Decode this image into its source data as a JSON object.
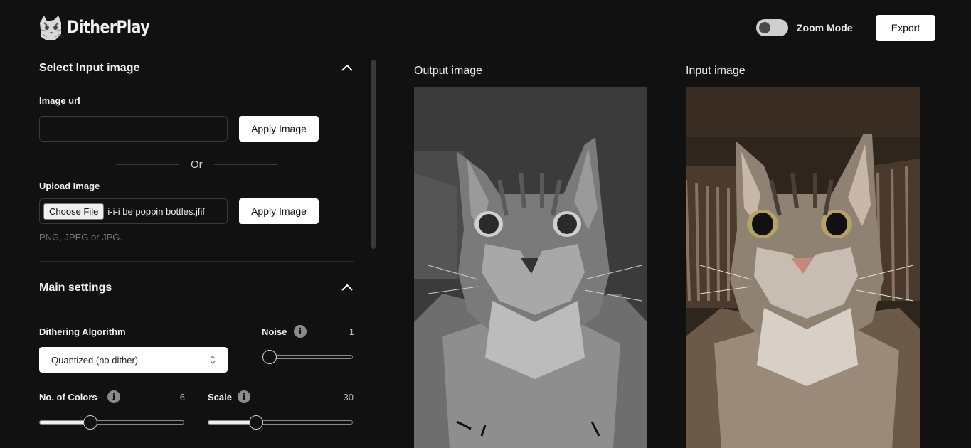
{
  "app": {
    "title": "DitherPlay"
  },
  "header": {
    "zoom_label": "Zoom Mode",
    "export_label": "Export"
  },
  "input_section": {
    "title": "Select Input image",
    "image_url_label": "Image url",
    "image_url_value": "",
    "apply_label": "Apply Image",
    "or_text": "Or",
    "upload_label": "Upload Image",
    "choose_file_label": "Choose File",
    "file_name": "i-i-i be poppin bottles.jfif",
    "upload_apply_label": "Apply Image",
    "hint": "PNG, JPEG or JPG."
  },
  "main_settings": {
    "title": "Main settings",
    "algorithm_label": "Dithering Algorithm",
    "algorithm_value": "Quantized (no dither)",
    "noise_label": "Noise",
    "noise_value": "1",
    "noise_fraction": 0.0,
    "colors_label": "No. of Colors",
    "colors_value": "6",
    "colors_fraction": 0.3,
    "scale_label": "Scale",
    "scale_value": "30",
    "scale_fraction": 0.28
  },
  "output": {
    "title": "Output image"
  },
  "input": {
    "title": "Input image"
  },
  "colors": {
    "background": "#121112",
    "button": "#ffffff"
  }
}
